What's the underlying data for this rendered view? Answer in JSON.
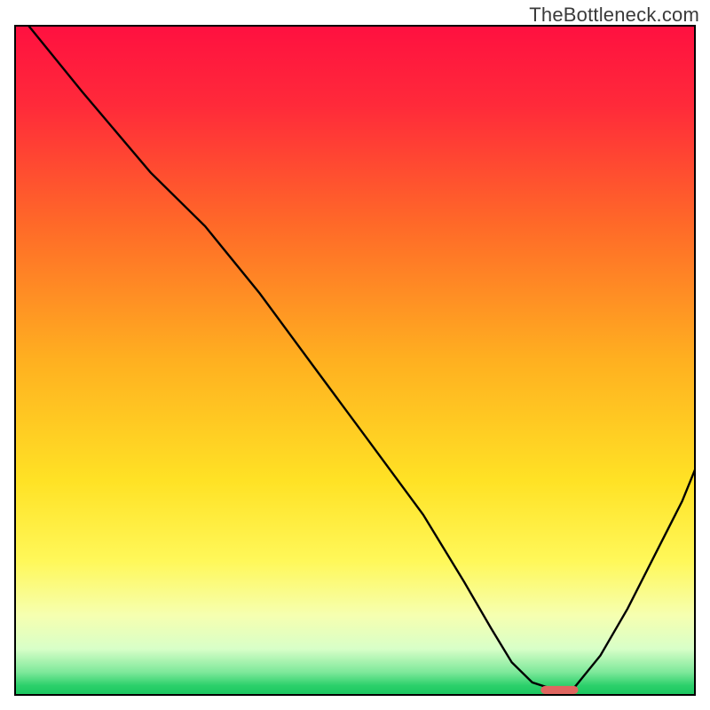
{
  "watermark": "TheBottleneck.com",
  "chart_data": {
    "type": "line",
    "title": "",
    "xlabel": "",
    "ylabel": "",
    "xlim": [
      0,
      100
    ],
    "ylim": [
      0,
      100
    ],
    "grid": false,
    "legend": false,
    "series": [
      {
        "name": "curve",
        "x": [
          2,
          10,
          20,
          28,
          36,
          44,
          52,
          60,
          66,
          70,
          73,
          76,
          79,
          82,
          86,
          90,
          94,
          98,
          100
        ],
        "y": [
          100,
          90,
          78,
          70,
          60,
          49,
          38,
          27,
          17,
          10,
          5,
          2,
          1,
          1,
          6,
          13,
          21,
          29,
          34
        ]
      }
    ],
    "marker": {
      "x_center": 80,
      "width_pct": 5.5,
      "height_pct": 1.2,
      "color": "#e06660"
    },
    "gradient_stops": [
      {
        "offset": 0.0,
        "color": "#ff1040"
      },
      {
        "offset": 0.12,
        "color": "#ff2a3a"
      },
      {
        "offset": 0.3,
        "color": "#ff6a28"
      },
      {
        "offset": 0.5,
        "color": "#ffb020"
      },
      {
        "offset": 0.68,
        "color": "#ffe225"
      },
      {
        "offset": 0.8,
        "color": "#fff85a"
      },
      {
        "offset": 0.88,
        "color": "#f6ffb0"
      },
      {
        "offset": 0.93,
        "color": "#d8ffc8"
      },
      {
        "offset": 0.965,
        "color": "#7de89a"
      },
      {
        "offset": 0.985,
        "color": "#2bd06a"
      },
      {
        "offset": 1.0,
        "color": "#19c45e"
      }
    ],
    "border_color": "#000000",
    "curve_color": "#000000"
  }
}
